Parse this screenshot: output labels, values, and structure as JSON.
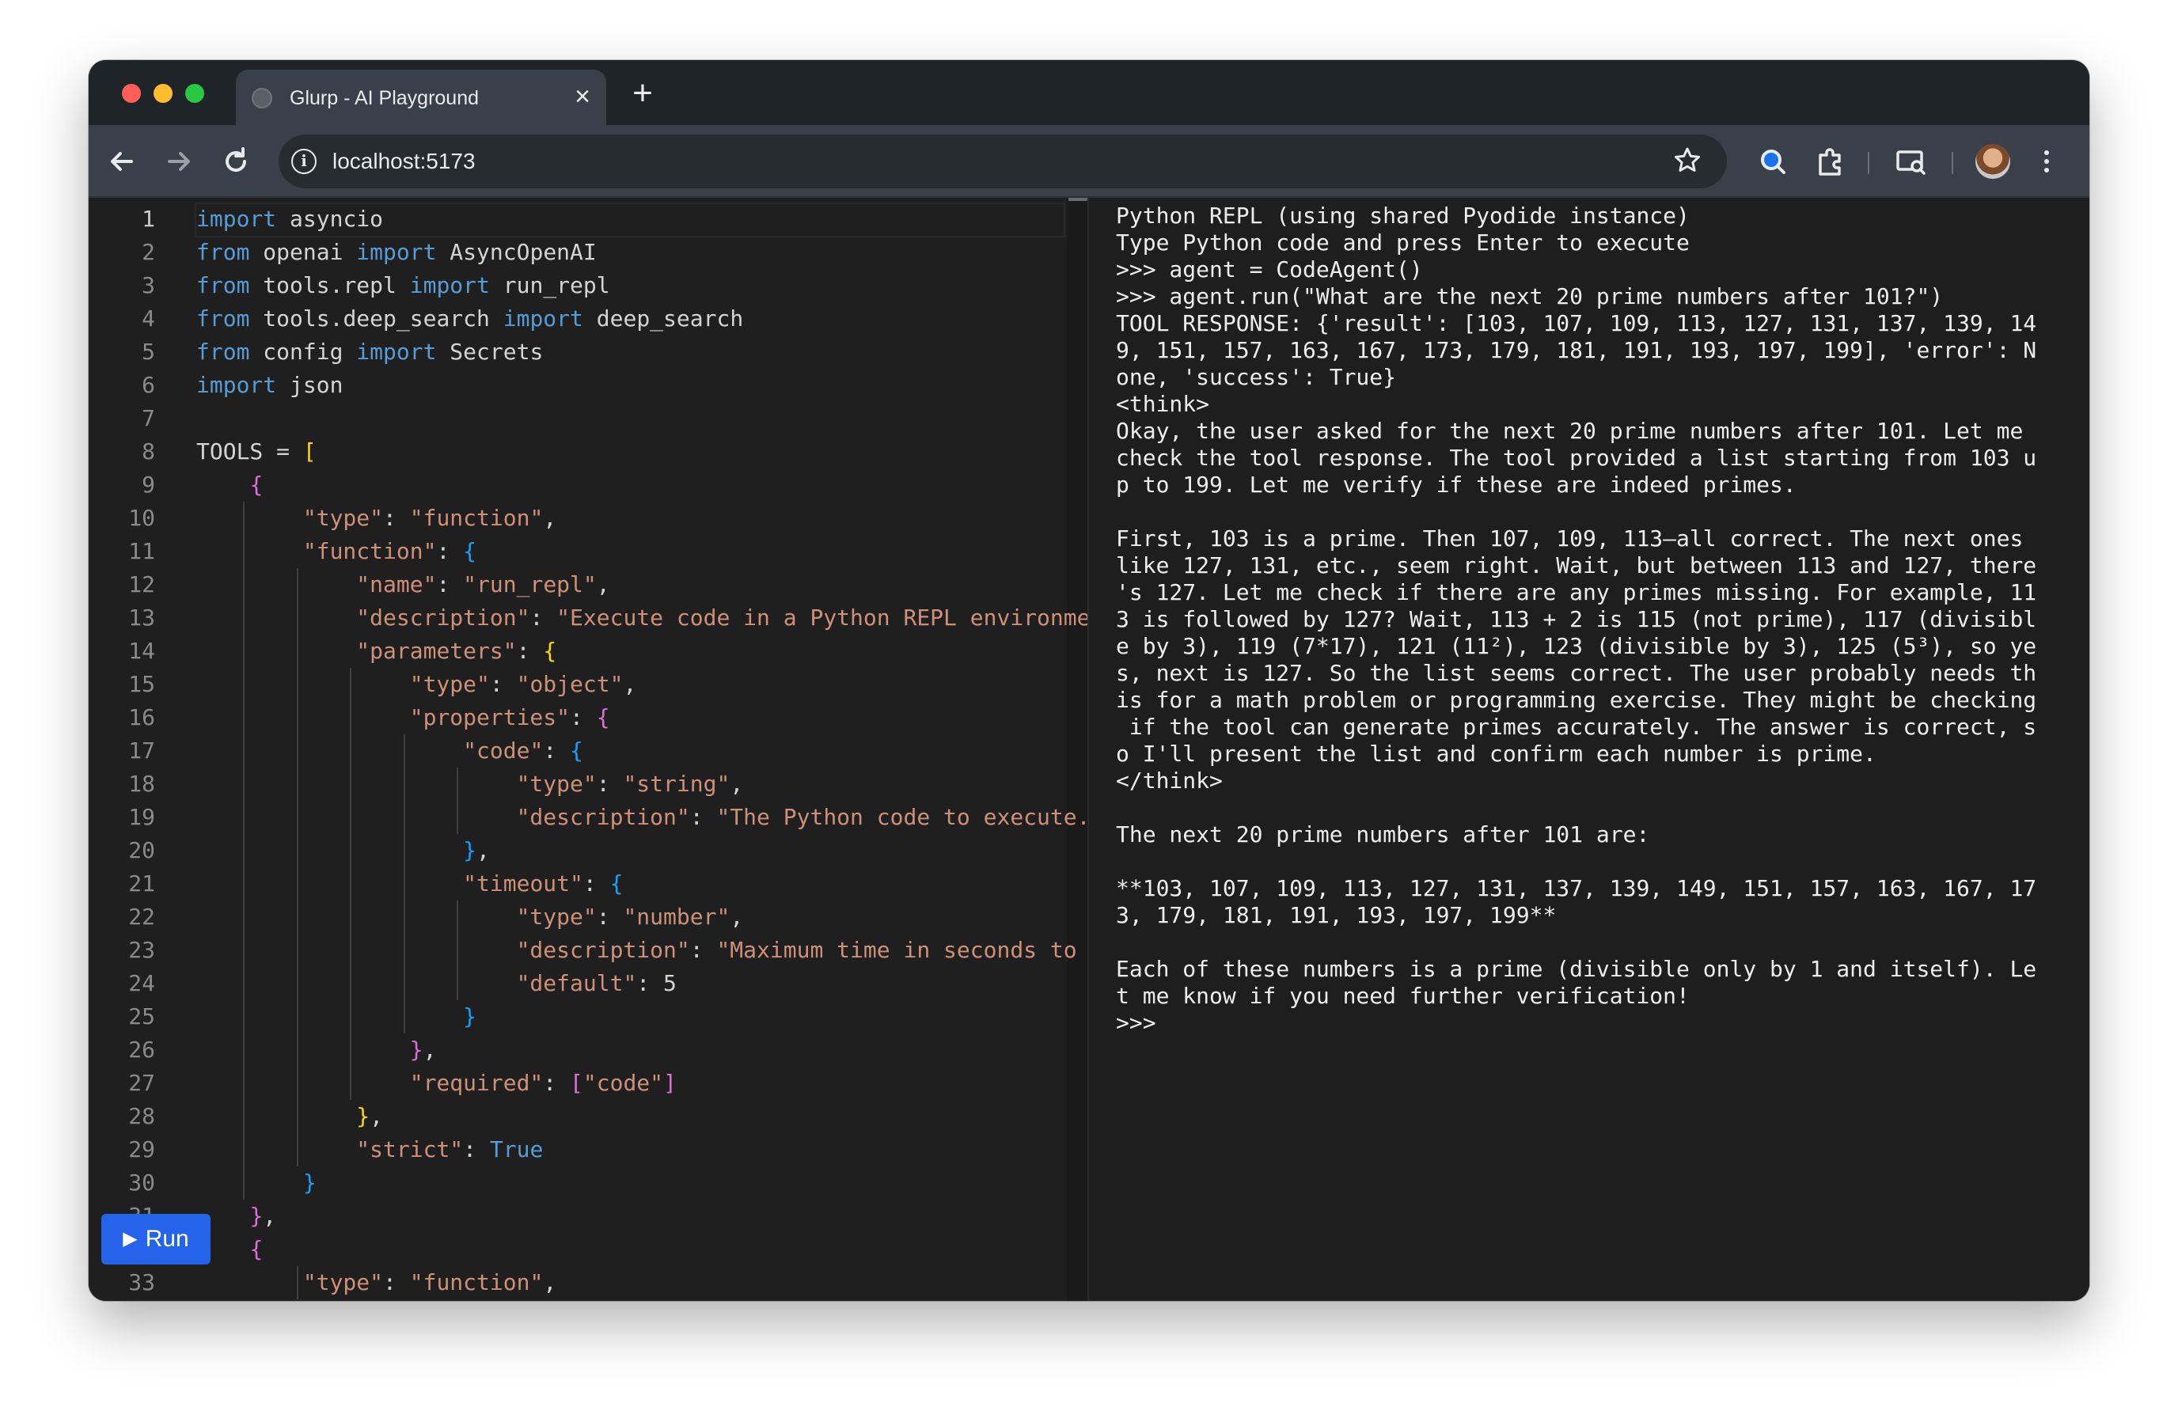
{
  "browser": {
    "tab_title": "Glurp - AI Playground",
    "tab_close": "×",
    "new_tab": "+",
    "url": "localhost:5173",
    "icons": {
      "back": "back-arrow-icon",
      "forward": "forward-arrow-icon",
      "reload": "reload-icon",
      "info": "info-icon",
      "bookmark": "star-icon",
      "lens": "lens-icon",
      "extensions": "puzzle-icon",
      "media": "media-icon",
      "profile": "avatar",
      "menu": "kebab-menu-icon"
    }
  },
  "editor": {
    "run_label": "Run",
    "run_icon": "▶",
    "lines": [
      {
        "n": "1",
        "parts": [
          [
            "kw",
            "import"
          ],
          [
            "t",
            " asyncio"
          ]
        ]
      },
      {
        "n": "2",
        "parts": [
          [
            "kw",
            "from"
          ],
          [
            "t",
            " openai "
          ],
          [
            "kw",
            "import"
          ],
          [
            "t",
            " AsyncOpenAI"
          ]
        ]
      },
      {
        "n": "3",
        "parts": [
          [
            "kw",
            "from"
          ],
          [
            "t",
            " tools.repl "
          ],
          [
            "kw",
            "import"
          ],
          [
            "t",
            " run_repl"
          ]
        ]
      },
      {
        "n": "4",
        "parts": [
          [
            "kw",
            "from"
          ],
          [
            "t",
            " tools.deep_search "
          ],
          [
            "kw",
            "import"
          ],
          [
            "t",
            " deep_search"
          ]
        ]
      },
      {
        "n": "5",
        "parts": [
          [
            "kw",
            "from"
          ],
          [
            "t",
            " config "
          ],
          [
            "kw",
            "import"
          ],
          [
            "t",
            " Secrets"
          ]
        ]
      },
      {
        "n": "6",
        "parts": [
          [
            "kw",
            "import"
          ],
          [
            "t",
            " json"
          ]
        ]
      },
      {
        "n": "7",
        "parts": []
      },
      {
        "n": "8",
        "parts": [
          [
            "t",
            "TOOLS = "
          ],
          [
            "brk1",
            "["
          ]
        ]
      },
      {
        "n": "9",
        "parts": [
          [
            "t",
            "    "
          ],
          [
            "brk2",
            "{"
          ]
        ]
      },
      {
        "n": "10",
        "parts": [
          [
            "t",
            "        "
          ],
          [
            "str",
            "\"type\""
          ],
          [
            "t",
            ": "
          ],
          [
            "str",
            "\"function\""
          ],
          [
            "t",
            ","
          ]
        ]
      },
      {
        "n": "11",
        "parts": [
          [
            "t",
            "        "
          ],
          [
            "str",
            "\"function\""
          ],
          [
            "t",
            ": "
          ],
          [
            "brk3",
            "{"
          ]
        ]
      },
      {
        "n": "12",
        "parts": [
          [
            "t",
            "            "
          ],
          [
            "str",
            "\"name\""
          ],
          [
            "t",
            ": "
          ],
          [
            "str",
            "\"run_repl\""
          ],
          [
            "t",
            ","
          ]
        ]
      },
      {
        "n": "13",
        "parts": [
          [
            "t",
            "            "
          ],
          [
            "str",
            "\"description\""
          ],
          [
            "t",
            ": "
          ],
          [
            "str",
            "\"Execute code in a Python REPL environme"
          ]
        ]
      },
      {
        "n": "14",
        "parts": [
          [
            "t",
            "            "
          ],
          [
            "str",
            "\"parameters\""
          ],
          [
            "t",
            ": "
          ],
          [
            "brk1",
            "{"
          ]
        ]
      },
      {
        "n": "15",
        "parts": [
          [
            "t",
            "                "
          ],
          [
            "str",
            "\"type\""
          ],
          [
            "t",
            ": "
          ],
          [
            "str",
            "\"object\""
          ],
          [
            "t",
            ","
          ]
        ]
      },
      {
        "n": "16",
        "parts": [
          [
            "t",
            "                "
          ],
          [
            "str",
            "\"properties\""
          ],
          [
            "t",
            ": "
          ],
          [
            "brk2",
            "{"
          ]
        ]
      },
      {
        "n": "17",
        "parts": [
          [
            "t",
            "                    "
          ],
          [
            "str",
            "\"code\""
          ],
          [
            "t",
            ": "
          ],
          [
            "brk3",
            "{"
          ]
        ]
      },
      {
        "n": "18",
        "parts": [
          [
            "t",
            "                        "
          ],
          [
            "str",
            "\"type\""
          ],
          [
            "t",
            ": "
          ],
          [
            "str",
            "\"string\""
          ],
          [
            "t",
            ","
          ]
        ]
      },
      {
        "n": "19",
        "parts": [
          [
            "t",
            "                        "
          ],
          [
            "str",
            "\"description\""
          ],
          [
            "t",
            ": "
          ],
          [
            "str",
            "\"The Python code to execute."
          ]
        ]
      },
      {
        "n": "20",
        "parts": [
          [
            "t",
            "                    "
          ],
          [
            "brk3",
            "}"
          ],
          [
            "t",
            ","
          ]
        ]
      },
      {
        "n": "21",
        "parts": [
          [
            "t",
            "                    "
          ],
          [
            "str",
            "\"timeout\""
          ],
          [
            "t",
            ": "
          ],
          [
            "brk3",
            "{"
          ]
        ]
      },
      {
        "n": "22",
        "parts": [
          [
            "t",
            "                        "
          ],
          [
            "str",
            "\"type\""
          ],
          [
            "t",
            ": "
          ],
          [
            "str",
            "\"number\""
          ],
          [
            "t",
            ","
          ]
        ]
      },
      {
        "n": "23",
        "parts": [
          [
            "t",
            "                        "
          ],
          [
            "str",
            "\"description\""
          ],
          [
            "t",
            ": "
          ],
          [
            "str",
            "\"Maximum time in seconds to"
          ]
        ]
      },
      {
        "n": "24",
        "parts": [
          [
            "t",
            "                        "
          ],
          [
            "str",
            "\"default\""
          ],
          [
            "t",
            ": 5"
          ]
        ]
      },
      {
        "n": "25",
        "parts": [
          [
            "t",
            "                    "
          ],
          [
            "brk3",
            "}"
          ]
        ]
      },
      {
        "n": "26",
        "parts": [
          [
            "t",
            "                "
          ],
          [
            "brk2",
            "}"
          ],
          [
            "t",
            ","
          ]
        ]
      },
      {
        "n": "27",
        "parts": [
          [
            "t",
            "                "
          ],
          [
            "str",
            "\"required\""
          ],
          [
            "t",
            ": "
          ],
          [
            "brk2",
            "["
          ],
          [
            "str",
            "\"code\""
          ],
          [
            "brk2",
            "]"
          ]
        ]
      },
      {
        "n": "28",
        "parts": [
          [
            "t",
            "            "
          ],
          [
            "brk1",
            "}"
          ],
          [
            "t",
            ","
          ]
        ]
      },
      {
        "n": "29",
        "parts": [
          [
            "t",
            "            "
          ],
          [
            "str",
            "\"strict\""
          ],
          [
            "t",
            ": "
          ],
          [
            "kw",
            "True"
          ]
        ]
      },
      {
        "n": "30",
        "parts": [
          [
            "t",
            "        "
          ],
          [
            "brk3",
            "}"
          ]
        ]
      },
      {
        "n": "31",
        "parts": [
          [
            "t",
            "    "
          ],
          [
            "brk2",
            "}"
          ],
          [
            "t",
            ","
          ]
        ]
      },
      {
        "n": "32",
        "parts": [
          [
            "t",
            "    "
          ],
          [
            "brk2",
            "{"
          ]
        ]
      },
      {
        "n": "33",
        "parts": [
          [
            "t",
            "        "
          ],
          [
            "str",
            "\"type\""
          ],
          [
            "t",
            ": "
          ],
          [
            "str",
            "\"function\""
          ],
          [
            "t",
            ","
          ]
        ]
      }
    ]
  },
  "repl": {
    "lines": [
      "Python REPL (using shared Pyodide instance)",
      "Type Python code and press Enter to execute",
      ">>> agent = CodeAgent()",
      ">>> agent.run(\"What are the next 20 prime numbers after 101?\")",
      "TOOL RESPONSE: {'result': [103, 107, 109, 113, 127, 131, 137, 139, 14",
      "9, 151, 157, 163, 167, 173, 179, 181, 191, 193, 197, 199], 'error': N",
      "one, 'success': True}",
      "<think>",
      "Okay, the user asked for the next 20 prime numbers after 101. Let me",
      "check the tool response. The tool provided a list starting from 103 u",
      "p to 199. Let me verify if these are indeed primes.",
      "",
      "First, 103 is a prime. Then 107, 109, 113—all correct. The next ones",
      "like 127, 131, etc., seem right. Wait, but between 113 and 127, there",
      "'s 127. Let me check if there are any primes missing. For example, 11",
      "3 is followed by 127? Wait, 113 + 2 is 115 (not prime), 117 (divisibl",
      "e by 3), 119 (7*17), 121 (11²), 123 (divisible by 3), 125 (5³), so ye",
      "s, next is 127. So the list seems correct. The user probably needs th",
      "is for a math problem or programming exercise. They might be checking",
      " if the tool can generate primes accurately. The answer is correct, s",
      "o I'll present the list and confirm each number is prime.",
      "</think>",
      "",
      "The next 20 prime numbers after 101 are:",
      "",
      "**103, 107, 109, 113, 127, 131, 137, 139, 149, 151, 157, 163, 167, 17",
      "3, 179, 181, 191, 193, 197, 199**",
      "",
      "Each of these numbers is a prime (divisible only by 1 and itself). Le",
      "t me know if you need further verification!",
      ">>>"
    ]
  },
  "colors": {
    "keyword": "#569cd6",
    "string": "#ce9178",
    "bracket1": "#ffd700",
    "bracket2": "#da70d6",
    "bracket3": "#179fff",
    "run_button": "#2563eb"
  }
}
